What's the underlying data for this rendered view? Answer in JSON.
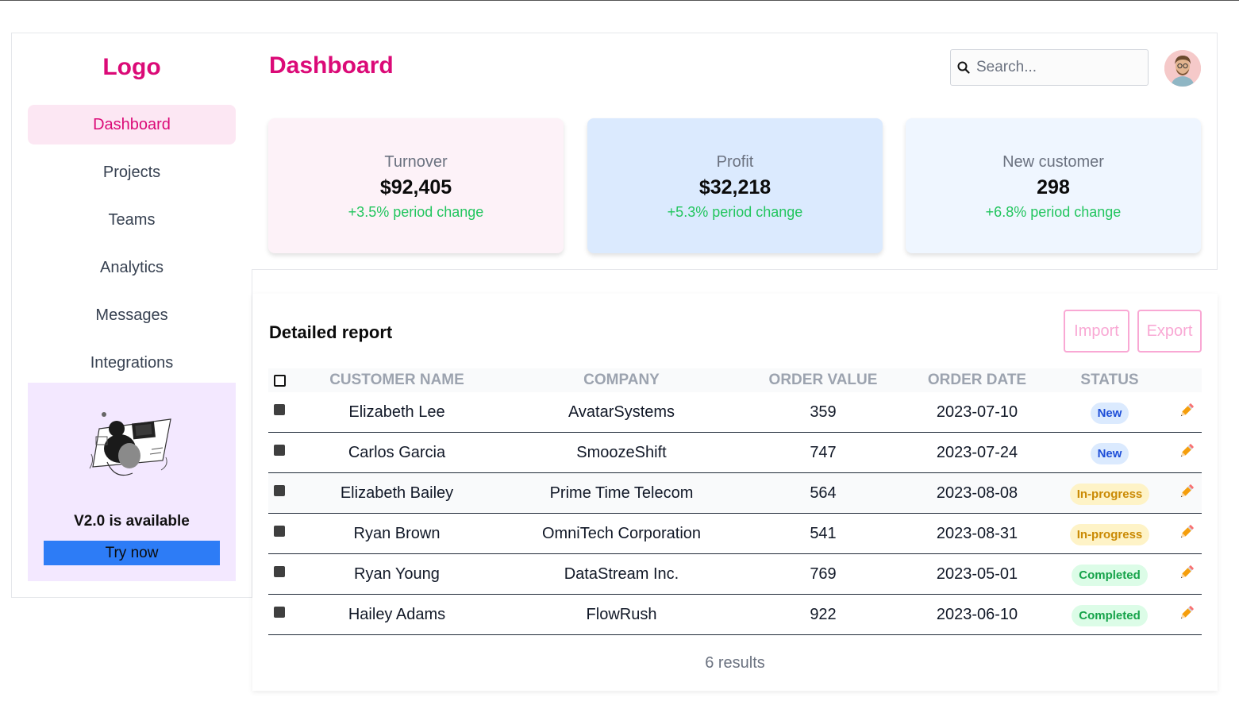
{
  "sidebar": {
    "logo": "Logo",
    "nav": [
      {
        "label": "Dashboard",
        "active": true
      },
      {
        "label": "Projects",
        "active": false
      },
      {
        "label": "Teams",
        "active": false
      },
      {
        "label": "Analytics",
        "active": false
      },
      {
        "label": "Messages",
        "active": false
      },
      {
        "label": "Integrations",
        "active": false
      }
    ],
    "promo": {
      "title": "V2.0 is available",
      "button": "Try now"
    }
  },
  "header": {
    "title": "Dashboard",
    "search_placeholder": "Search..."
  },
  "stats": [
    {
      "label": "Turnover",
      "value": "$92,405",
      "change": "+3.5% period change",
      "bg": "#fdf2f8"
    },
    {
      "label": "Profit",
      "value": "$32,218",
      "change": "+5.3% period change",
      "bg": "#dbeafe"
    },
    {
      "label": "New customer",
      "value": "298",
      "change": "+6.8% period change",
      "bg": "#eff6ff"
    }
  ],
  "report": {
    "title": "Detailed report",
    "import_label": "Import",
    "export_label": "Export",
    "columns": [
      "CUSTOMER NAME",
      "COMPANY",
      "ORDER VALUE",
      "ORDER DATE",
      "STATUS"
    ],
    "rows": [
      {
        "name": "Elizabeth Lee",
        "company": "AvatarSystems",
        "value": "359",
        "date": "2023-07-10",
        "status": "New",
        "status_type": "new"
      },
      {
        "name": "Carlos Garcia",
        "company": "SmoozeShift",
        "value": "747",
        "date": "2023-07-24",
        "status": "New",
        "status_type": "new"
      },
      {
        "name": "Elizabeth Bailey",
        "company": "Prime Time Telecom",
        "value": "564",
        "date": "2023-08-08",
        "status": "In-progress",
        "status_type": "progress"
      },
      {
        "name": "Ryan Brown",
        "company": "OmniTech Corporation",
        "value": "541",
        "date": "2023-08-31",
        "status": "In-progress",
        "status_type": "progress"
      },
      {
        "name": "Ryan Young",
        "company": "DataStream Inc.",
        "value": "769",
        "date": "2023-05-01",
        "status": "Completed",
        "status_type": "done"
      },
      {
        "name": "Hailey Adams",
        "company": "FlowRush",
        "value": "922",
        "date": "2023-06-10",
        "status": "Completed",
        "status_type": "done"
      }
    ],
    "results": "6 results"
  },
  "colors": {
    "brand": "#db0a77",
    "active_nav_bg": "#fce7f3",
    "promo_bg": "#f3e8ff",
    "promo_button": "#2d7cf6",
    "positive": "#22c55e"
  },
  "icons": {
    "search": "search-icon",
    "edit": "pencil-icon",
    "avatar": "user-avatar"
  }
}
